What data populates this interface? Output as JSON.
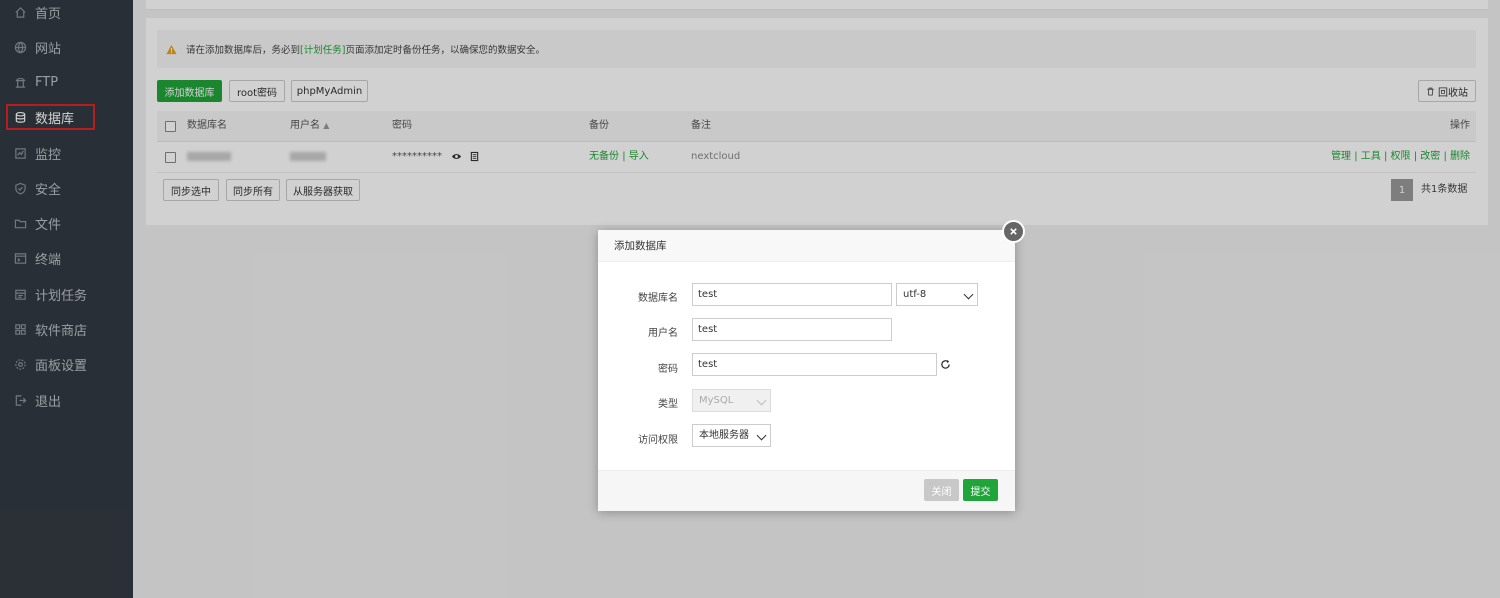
{
  "sidebar": {
    "items": [
      {
        "label": "首页",
        "icon": "home-icon"
      },
      {
        "label": "网站",
        "icon": "globe-icon"
      },
      {
        "label": "FTP",
        "icon": "ftp-icon"
      },
      {
        "label": "数据库",
        "icon": "database-icon"
      },
      {
        "label": "监控",
        "icon": "monitor-icon"
      },
      {
        "label": "安全",
        "icon": "shield-icon"
      },
      {
        "label": "文件",
        "icon": "folder-icon"
      },
      {
        "label": "终端",
        "icon": "terminal-icon"
      },
      {
        "label": "计划任务",
        "icon": "calendar-icon"
      },
      {
        "label": "软件商店",
        "icon": "apps-icon"
      },
      {
        "label": "面板设置",
        "icon": "gear-icon"
      },
      {
        "label": "退出",
        "icon": "logout-icon"
      }
    ],
    "active": "数据库"
  },
  "alert": {
    "prefix": "请在添加数据库后，务必到",
    "link": "[计划任务]",
    "suffix": "页面添加定时备份任务，以确保您的数据安全。"
  },
  "toolbar": {
    "add_db": "添加数据库",
    "root_pw": "root密码",
    "phpmyadmin": "phpMyAdmin",
    "recycle": "回收站"
  },
  "table": {
    "headers": {
      "name": "数据库名",
      "user": "用户名",
      "password": "密码",
      "backup": "备份",
      "note": "备注",
      "actions": "操作"
    },
    "rows": [
      {
        "password": "**********",
        "backup": "无备份",
        "import": "导入",
        "note": "nextcloud",
        "actions": [
          "管理",
          "工具",
          "权限",
          "改密",
          "删除"
        ]
      }
    ]
  },
  "bottom": {
    "sync_selected": "同步选中",
    "sync_all": "同步所有",
    "fetch_server": "从服务器获取",
    "page": "1",
    "total": "共1条数据"
  },
  "modal": {
    "title": "添加数据库",
    "fields": {
      "dbname_label": "数据库名",
      "dbname_value": "test",
      "charset": "utf-8",
      "user_label": "用户名",
      "user_value": "test",
      "pw_label": "密码",
      "pw_value": "test",
      "type_label": "类型",
      "type_value": "MySQL",
      "access_label": "访问权限",
      "access_value": "本地服务器"
    },
    "close_btn": "关闭",
    "submit_btn": "提交"
  },
  "colors": {
    "accent": "#20a53a",
    "sidebar_bg": "#333a42",
    "highlight_border": "#e02424"
  }
}
